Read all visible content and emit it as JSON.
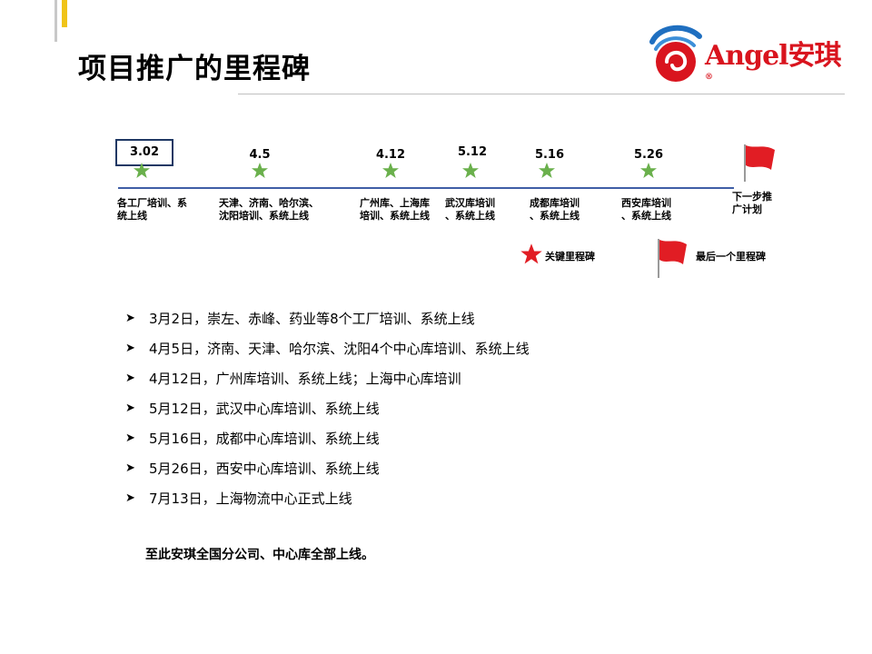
{
  "header": {
    "title": "项目推广的里程碑"
  },
  "logo": {
    "brand": "Angel安琪",
    "reg": "®"
  },
  "timeline": {
    "milestones": [
      {
        "date": "3.02",
        "desc": "各工厂培训、系\n统上线"
      },
      {
        "date": "4.5",
        "desc": "天津、济南、哈尔滨、\n沈阳培训、系统上线"
      },
      {
        "date": "4.12",
        "desc": "广州库、上海库\n培训、系统上线"
      },
      {
        "date": "5.12",
        "desc": "武汉库培训\n、系统上线"
      },
      {
        "date": "5.16",
        "desc": "成都库培训\n、系统上线"
      },
      {
        "date": "5.26",
        "desc": "西安库培训\n、系统上线"
      }
    ],
    "next_step": "下一步推\n广计划"
  },
  "legend": {
    "key_milestone": "关键里程碑",
    "final_milestone": "最后一个里程碑"
  },
  "bullets": [
    "3月2日，崇左、赤峰、药业等8个工厂培训、系统上线",
    "4月5日，济南、天津、哈尔滨、沈阳4个中心库培训、系统上线",
    "4月12日，广州库培训、系统上线；上海中心库培训",
    "5月12日，武汉中心库培训、系统上线",
    "5月16日，成都中心库培训、系统上线",
    "5月26日，西安中心库培训、系统上线",
    "7月13日，上海物流中心正式上线"
  ],
  "summary": "至此安琪全国分公司、中心库全部上线。",
  "colors": {
    "accent_gold": "#f0c419",
    "brand_red": "#d9141e",
    "star_green": "#6ab04c",
    "timeline_blue": "#3f5ea6"
  },
  "icons": {
    "bullet": "arrow-right-icon",
    "milestone": "star-icon",
    "flag": "red-flag-icon"
  }
}
